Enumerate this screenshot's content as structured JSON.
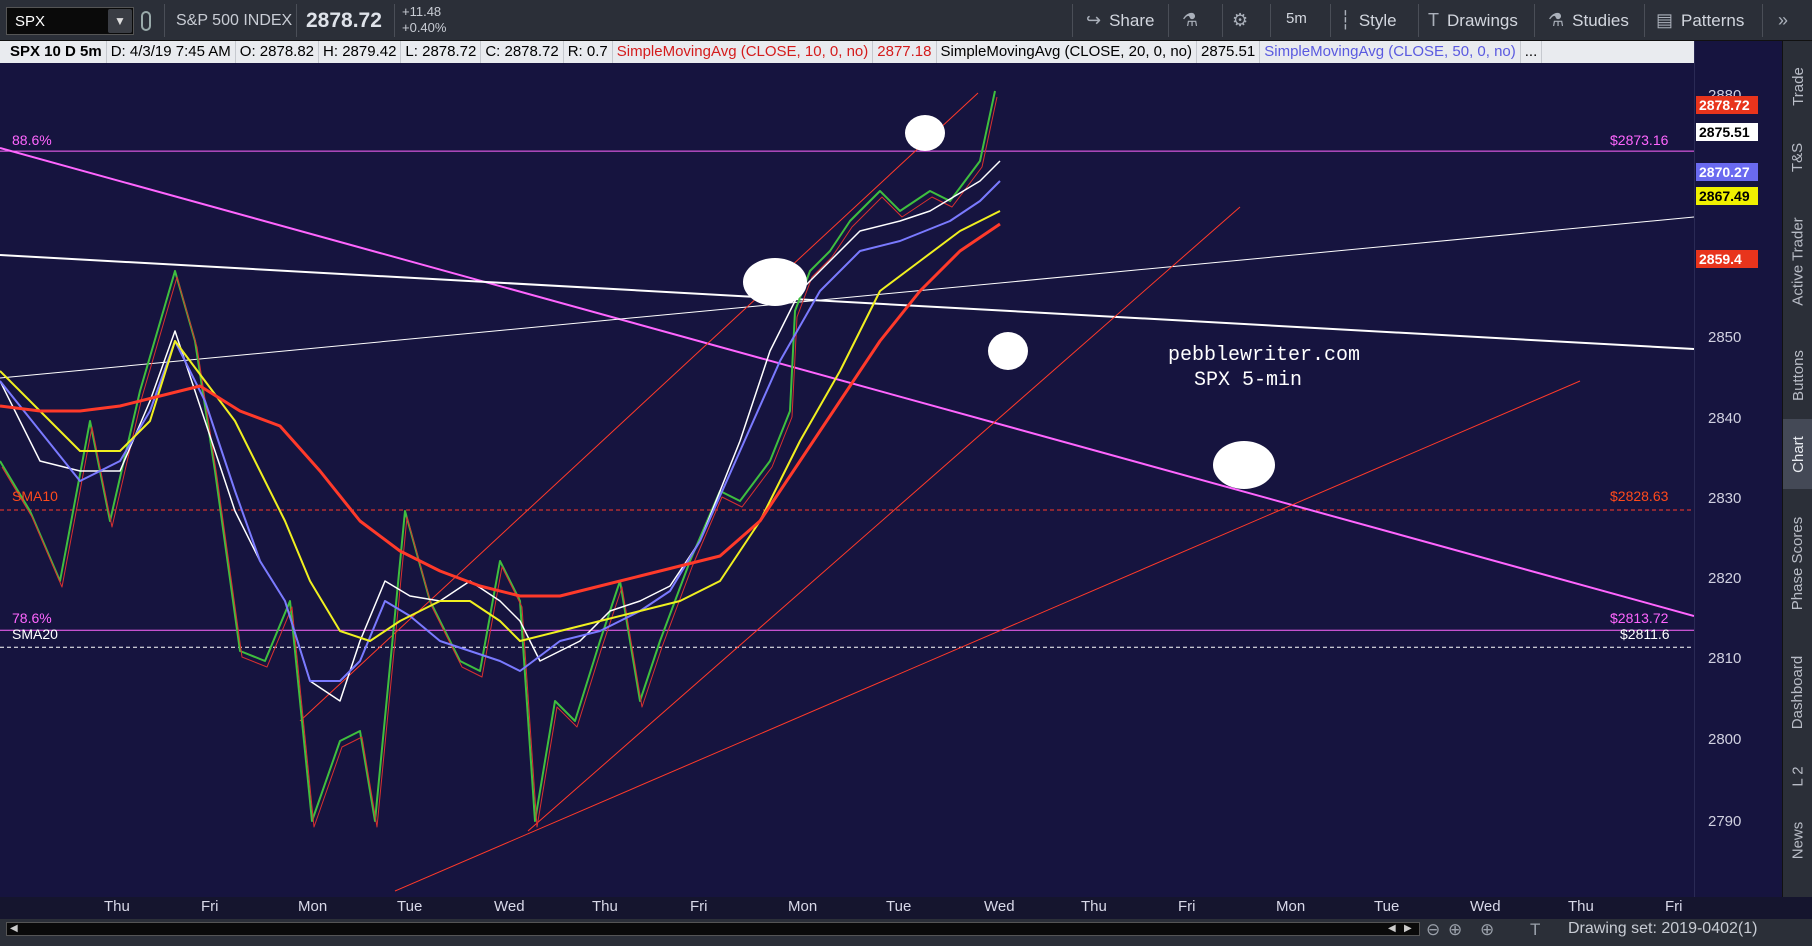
{
  "toolbar": {
    "symbol": "SPX",
    "company": "S&P 500 INDEX",
    "last": "2878.72",
    "change": "+11.48",
    "change_pct": "+0.40%",
    "share": "Share",
    "interval": "5m",
    "style": "Style",
    "drawings": "Drawings",
    "studies": "Studies",
    "patterns": "Patterns"
  },
  "info": {
    "symbol": "SPX 10 D 5m",
    "datetime": "D: 4/3/19 7:45 AM",
    "open": "O: 2878.82",
    "high": "H: 2879.42",
    "low": "L: 2878.72",
    "close": "C: 2878.72",
    "range": "R: 0.7",
    "sma10_label": "SimpleMovingAvg (CLOSE, 10, 0, no)",
    "sma10_value": "2877.18",
    "sma20_label": "SimpleMovingAvg (CLOSE, 20, 0, no)",
    "sma20_value": "2875.51",
    "sma50_label": "SimpleMovingAvg (CLOSE, 50, 0, no)",
    "sma50_value": "..."
  },
  "price_axis": {
    "ticks": [
      "2880",
      "2870",
      "2860",
      "2850",
      "2840",
      "2830",
      "2820",
      "2810",
      "2800",
      "2790"
    ],
    "tags": [
      {
        "text": "2878.72",
        "bg": "#e8341c",
        "fg": "#ffffff"
      },
      {
        "text": "2875.51",
        "bg": "#ffffff",
        "fg": "#000000"
      },
      {
        "text": "2870.27",
        "bg": "#6a6af0",
        "fg": "#ffffff"
      },
      {
        "text": "2867.49",
        "bg": "#f0f000",
        "fg": "#000000"
      },
      {
        "text": "2859.4",
        "bg": "#e8341c",
        "fg": "#ffffff"
      }
    ]
  },
  "date_axis": [
    "Thu",
    "Fri",
    "Mon",
    "Tue",
    "Wed",
    "Thu",
    "Fri",
    "Mon",
    "Tue",
    "Wed",
    "Thu",
    "Fri",
    "Mon",
    "Tue",
    "Wed",
    "Thu",
    "Fri"
  ],
  "levels": {
    "fib_886": "88.6%",
    "fib_886_price": "$2873.16",
    "sma10": "SMA10",
    "sma10_price": "$2828.63",
    "fib_786": "78.6%",
    "fib_786_price": "$2813.72",
    "sma20": "SMA20",
    "sma20_price": "$2811.6"
  },
  "annotation": {
    "site": "pebblewriter.com",
    "caption": "SPX 5-min"
  },
  "side_tabs": [
    "Trade",
    "T&S",
    "Active Trader",
    "Buttons",
    "Chart",
    "Phase Scores",
    "Dashboard",
    "L 2",
    "News"
  ],
  "bottom": {
    "drawing_set": "Drawing set: 2019-0402(1)"
  },
  "colors": {
    "background": "#16143f",
    "sma10": "#ff4a1c",
    "sma20": "#ffffff",
    "sma50": "#7a7aff",
    "sma_yellow": "#f0f020",
    "fib": "#ff66ff",
    "channel": "#ff3a2a"
  }
}
